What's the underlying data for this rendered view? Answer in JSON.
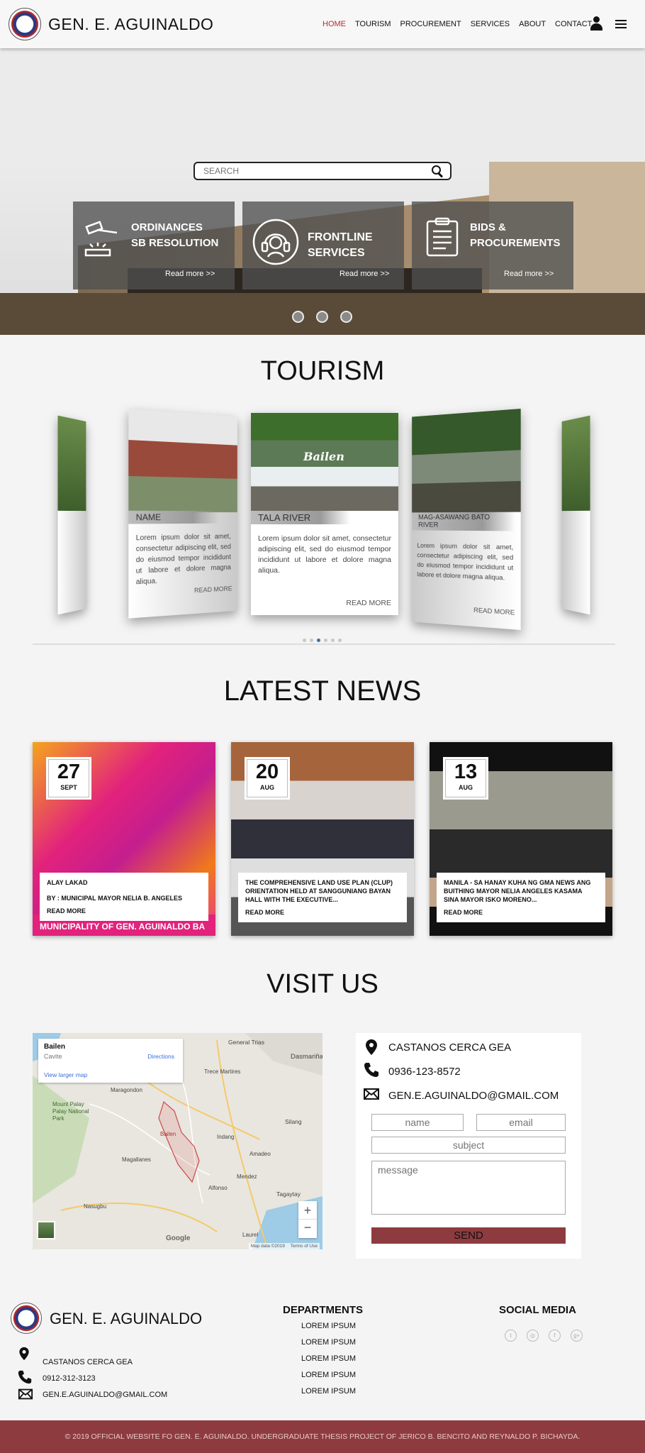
{
  "header": {
    "title": "GEN. E. AGUINALDO",
    "nav": [
      "HOME",
      "TOURISM",
      "PROCUREMENT",
      "SERVICES",
      "ABOUT",
      "CONTACT"
    ],
    "active_nav": "HOME"
  },
  "hero": {
    "search_placeholder": "SEARCH",
    "cards": [
      {
        "title_line1": "ORDINANCES",
        "title_line2": "SB RESOLUTION",
        "more": "Read more >>",
        "icon": "gavel-icon"
      },
      {
        "title_line1": "FRONTLINE",
        "title_line2": "SERVICES",
        "more": "Read more >>",
        "icon": "headset-icon"
      },
      {
        "title_line1": "BIDS &",
        "title_line2": "PROCUREMENTS",
        "more": "Read more >>",
        "icon": "clipboard-icon"
      }
    ],
    "slides": 3
  },
  "tourism": {
    "title": "TOURISM",
    "cards": [
      {
        "name": "NAME",
        "text": "Lorem ipsum dolor sit amet, consectetur adipiscing elit, sed do eiusmod tempor incididunt ut labore et dolore magna aliqua.",
        "more": "READ MORE"
      },
      {
        "name": "TALA RIVER",
        "image_caption": "Bailen",
        "text": "Lorem ipsum dolor sit amet, consectetur adipiscing elit, sed do eiusmod tempor incididunt ut labore et dolore magna aliqua.",
        "more": "READ MORE"
      },
      {
        "name": "MAG-ASAWANG BATO RIVER",
        "text": "Lorem ipsum dolor sit amet, consectetur adipiscing elit, sed do eiusmod tempor incididunt ut labore et dolore magna aliqua.",
        "more": "READ MORE"
      }
    ],
    "active_page": 3,
    "pages": 6
  },
  "news": {
    "title": "LATEST NEWS",
    "items": [
      {
        "day": "27",
        "month": "SEPT",
        "headline": "ALAY LAKAD",
        "byline": "BY : MUNICIPAL MAYOR  NELIA B. ANGELES",
        "more": "READ MORE",
        "banner": "MUNICIPALITY OF GEN. AGUINALDO BA"
      },
      {
        "day": "20",
        "month": "AUG",
        "headline": "THE COMPREHENSIVE LAND USE PLAN (CLUP) ORIENTATION HELD AT SANGGUNIANG BAYAN HALL WITH THE EXECUTIVE...",
        "more": "READ MORE"
      },
      {
        "day": "13",
        "month": "AUG",
        "headline": "MANILA - SA HANAY KUHA NG GMA NEWS ANG BUITHING MAYOR NELIA ANGELES KASAMA SINA MAYOR ISKO MORENO...",
        "more": "READ MORE"
      }
    ]
  },
  "visit": {
    "title": "VISIT US",
    "map": {
      "place": "Bailen",
      "region": "Cavite",
      "directions": "Directions",
      "larger": "View larger map",
      "labels": [
        "General Trias",
        "Dasmariñas",
        "Trece Martires",
        "Maragondon",
        "Mount Palay Palay National Park",
        "Bailen",
        "Silang",
        "Indang",
        "Amadeo",
        "Magallanes",
        "Alfonso",
        "Mendez",
        "Tagaytay",
        "Nasugbu",
        "Laurel"
      ],
      "attribution": "Map data ©2019",
      "terms": "Terms of Use",
      "logo": "Google"
    },
    "contact": {
      "address": "CASTANOS CERCA GEA",
      "phone": "0936-123-8572",
      "email": "GEN.E.AGUINALDO@GMAIL.COM"
    },
    "form": {
      "name_placeholder": "name",
      "email_placeholder": "email",
      "subject_placeholder": "subject",
      "message_placeholder": "message",
      "send_label": "SEND"
    }
  },
  "footer": {
    "title": "GEN. E. AGUINALDO",
    "address": "CASTANOS CERCA GEA",
    "phone": "0912-312-3123",
    "email": "GEN.E.AGUINALDO@GMAIL.COM",
    "departments_title": "DEPARTMENTS",
    "departments": [
      "LOREM IPSUM",
      "LOREM IPSUM",
      "LOREM IPSUM",
      "LOREM IPSUM",
      "LOREM IPSUM"
    ],
    "social_title": "SOCIAL MEDIA",
    "social_icons": [
      "twitter-icon",
      "instagram-icon",
      "facebook-icon",
      "google-plus-icon"
    ],
    "copyright": "© 2019 OFFICIAL WEBSITE FO GEN. E. AGUINALDO. UNDERGRADUATE THESIS PROJECT OF JERICO B. BENCITO AND REYNALDO P. BICHAYDA."
  },
  "colors": {
    "accent": "#8e3b3f",
    "active_nav": "#c0282d",
    "active_dot": "#3a6fb0"
  }
}
